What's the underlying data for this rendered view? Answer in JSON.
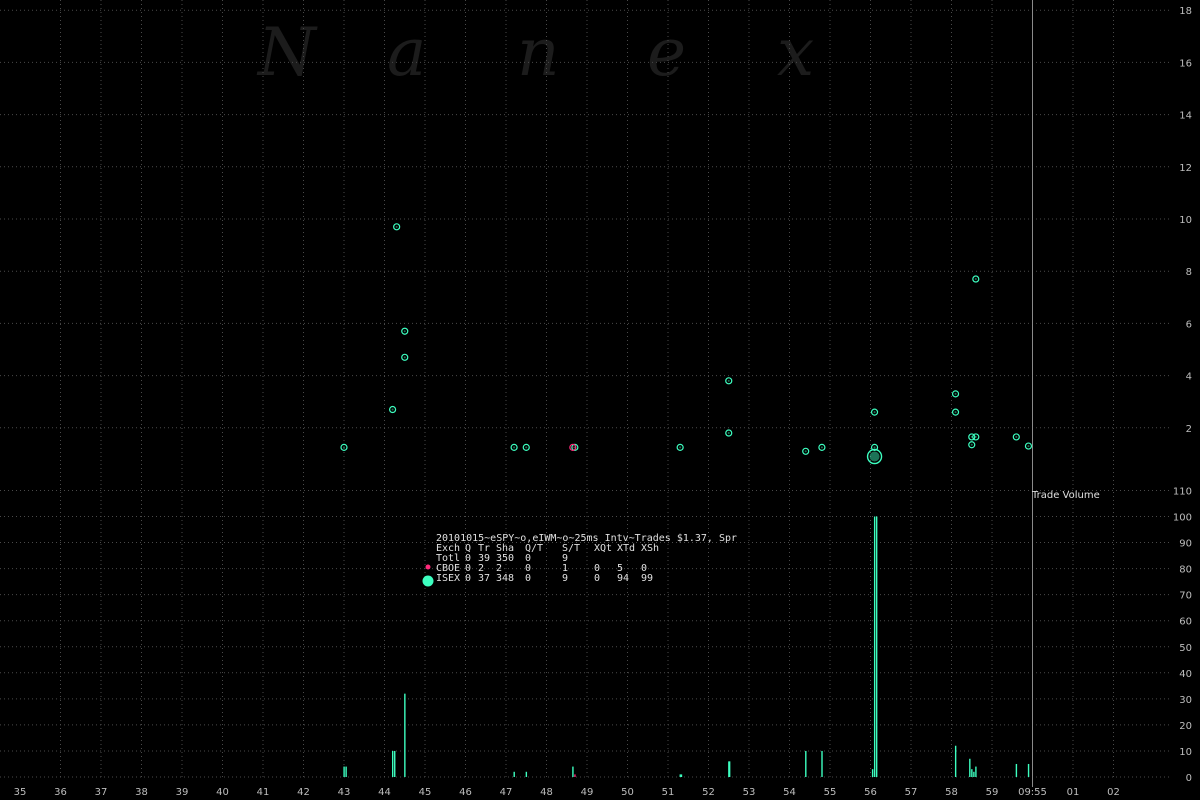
{
  "watermark": [
    "N",
    "a",
    "n",
    "e",
    "x"
  ],
  "x_axis": {
    "labels": [
      "35",
      "36",
      "37",
      "38",
      "39",
      "40",
      "41",
      "42",
      "43",
      "44",
      "45",
      "46",
      "47",
      "48",
      "49",
      "50",
      "51",
      "52",
      "53",
      "54",
      "55",
      "56",
      "57",
      "58",
      "59",
      "09:55",
      "01",
      "02"
    ]
  },
  "volume_label": "Trade Volume",
  "stats": {
    "title": "20101015~eSPY~o,eIWM~o~25ms Intv~Trades $1.37, Spr",
    "header": [
      "Exch",
      "Q",
      "Tr",
      "Sha",
      "Q/T",
      "S/T",
      "XQt",
      "XTd",
      "XSh"
    ],
    "rows": [
      {
        "marker": "",
        "cells": [
          "Totl",
          "0",
          "39",
          "350",
          "0",
          "9",
          "",
          "",
          ""
        ]
      },
      {
        "marker": "#ff2a7a",
        "cells": [
          "CBOE",
          "0",
          "2",
          "2",
          "0",
          "1",
          "0",
          "5",
          "0"
        ]
      },
      {
        "marker": "#3dffc0",
        "cells": [
          "ISEX",
          "0",
          "37",
          "348",
          "0",
          "9",
          "0",
          "94",
          "99"
        ]
      }
    ]
  },
  "colors": {
    "isex": "#3dffc0",
    "cboe": "#ff2a7a",
    "grid": "#4a4a4a",
    "axis_text": "#bdbdbd"
  },
  "chart_data": [
    {
      "type": "scatter",
      "title": "",
      "xlabel": "",
      "ylabel": "",
      "xlim": [
        34.6,
        62.5
      ],
      "ylim": [
        0,
        18
      ],
      "y_ticks": [
        2,
        4,
        6,
        8,
        10,
        12,
        14,
        16,
        18
      ],
      "grid": true,
      "series": [
        {
          "name": "ISEX",
          "points": [
            {
              "x": 43.0,
              "y": 1.25,
              "size": 1
            },
            {
              "x": 44.2,
              "y": 2.7,
              "size": 1
            },
            {
              "x": 44.3,
              "y": 9.7,
              "size": 1
            },
            {
              "x": 44.5,
              "y": 5.7,
              "size": 1
            },
            {
              "x": 44.5,
              "y": 4.7,
              "size": 1
            },
            {
              "x": 47.2,
              "y": 1.25,
              "size": 1
            },
            {
              "x": 47.5,
              "y": 1.25,
              "size": 1
            },
            {
              "x": 48.7,
              "y": 1.25,
              "size": 1
            },
            {
              "x": 51.3,
              "y": 1.25,
              "size": 1
            },
            {
              "x": 52.5,
              "y": 3.8,
              "size": 1
            },
            {
              "x": 52.5,
              "y": 1.8,
              "size": 1
            },
            {
              "x": 54.4,
              "y": 1.1,
              "size": 1
            },
            {
              "x": 54.8,
              "y": 1.25,
              "size": 1
            },
            {
              "x": 56.1,
              "y": 2.6,
              "size": 1
            },
            {
              "x": 56.1,
              "y": 1.25,
              "size": 1
            },
            {
              "x": 56.1,
              "y": 0.9,
              "size": 3
            },
            {
              "x": 58.1,
              "y": 3.3,
              "size": 1
            },
            {
              "x": 58.1,
              "y": 2.6,
              "size": 1
            },
            {
              "x": 58.5,
              "y": 1.65,
              "size": 1
            },
            {
              "x": 58.6,
              "y": 1.65,
              "size": 1
            },
            {
              "x": 58.5,
              "y": 1.35,
              "size": 1
            },
            {
              "x": 58.6,
              "y": 7.7,
              "size": 1
            },
            {
              "x": 59.6,
              "y": 1.65,
              "size": 1
            },
            {
              "x": 59.9,
              "y": 1.3,
              "size": 1
            }
          ]
        },
        {
          "name": "CBOE",
          "points": [
            {
              "x": 48.65,
              "y": 1.25,
              "size": 1
            }
          ]
        }
      ],
      "reference_line": {
        "x": 60.0
      }
    },
    {
      "type": "bar",
      "title": "",
      "xlabel": "",
      "ylabel": "Trade Volume",
      "xlim": [
        34.6,
        62.5
      ],
      "ylim": [
        0,
        110
      ],
      "y_ticks": [
        0,
        10,
        20,
        30,
        40,
        50,
        60,
        70,
        80,
        90,
        100,
        110
      ],
      "grid": true,
      "series": [
        {
          "name": "ISEX",
          "bars": [
            {
              "x": 43.0,
              "value": 4
            },
            {
              "x": 43.05,
              "value": 4
            },
            {
              "x": 44.2,
              "value": 10
            },
            {
              "x": 44.25,
              "value": 10
            },
            {
              "x": 44.5,
              "value": 32
            },
            {
              "x": 47.2,
              "value": 2
            },
            {
              "x": 47.5,
              "value": 2
            },
            {
              "x": 48.65,
              "value": 4
            },
            {
              "x": 51.3,
              "value": 1
            },
            {
              "x": 51.33,
              "value": 1
            },
            {
              "x": 52.5,
              "value": 6
            },
            {
              "x": 52.52,
              "value": 6
            },
            {
              "x": 54.4,
              "value": 10
            },
            {
              "x": 54.8,
              "value": 10
            },
            {
              "x": 56.05,
              "value": 3
            },
            {
              "x": 56.1,
              "value": 100
            },
            {
              "x": 56.15,
              "value": 100
            },
            {
              "x": 58.1,
              "value": 12
            },
            {
              "x": 58.45,
              "value": 7
            },
            {
              "x": 58.5,
              "value": 3
            },
            {
              "x": 58.55,
              "value": 2
            },
            {
              "x": 58.6,
              "value": 4
            },
            {
              "x": 59.6,
              "value": 5
            },
            {
              "x": 59.9,
              "value": 5
            }
          ]
        },
        {
          "name": "CBOE",
          "bars": [
            {
              "x": 48.7,
              "value": 1
            }
          ]
        }
      ]
    }
  ]
}
